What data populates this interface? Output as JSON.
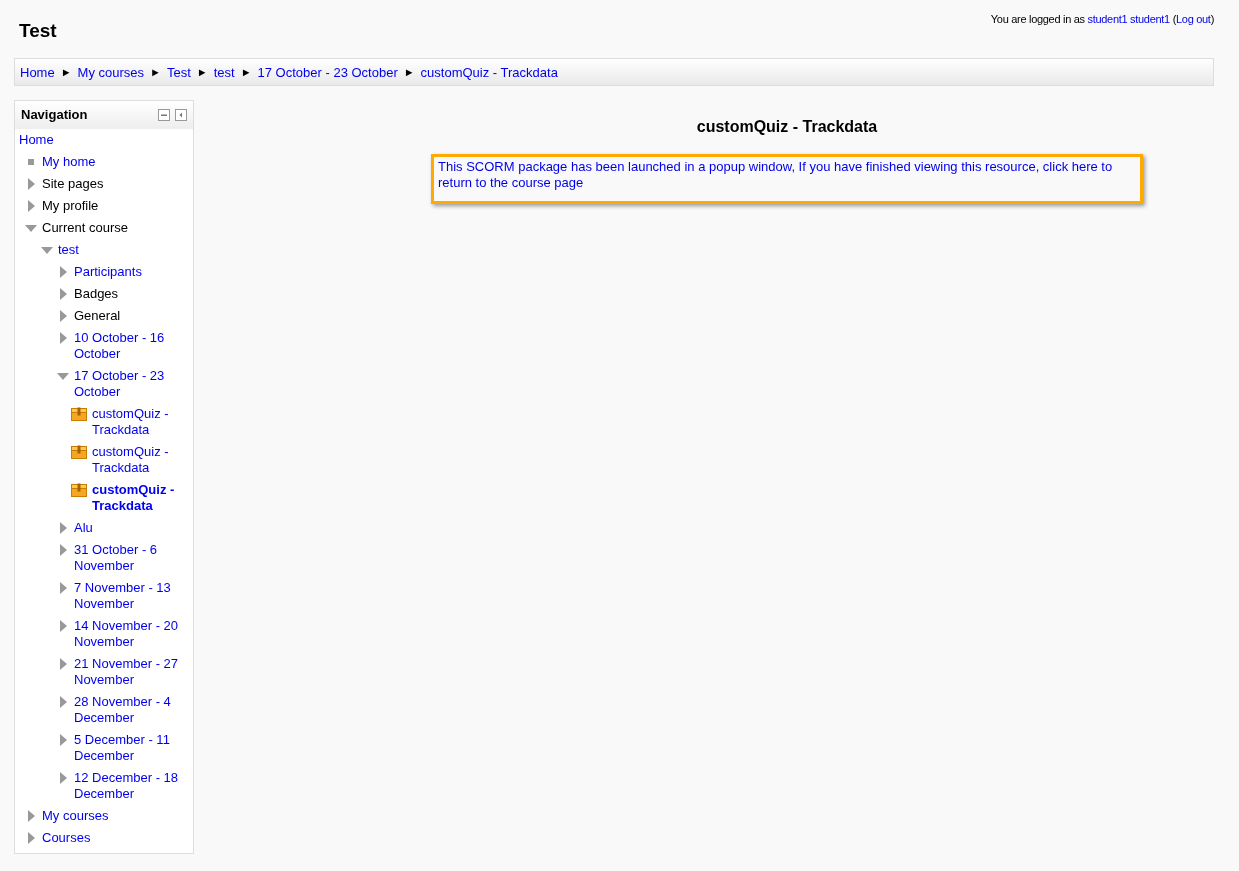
{
  "header": {
    "title": "Test",
    "login": {
      "prefix": "You are logged in as",
      "user": "student1 student1",
      "open": "(",
      "logout": "Log out",
      "close": ")"
    }
  },
  "breadcrumb": [
    {
      "label": "Home"
    },
    {
      "label": "My courses"
    },
    {
      "label": "Test"
    },
    {
      "label": "test"
    },
    {
      "label": "17 October - 23 October"
    },
    {
      "label": "customQuiz - Trackdata"
    }
  ],
  "breadcrumb_separator": "►",
  "navigation": {
    "title": "Navigation",
    "items": [
      {
        "label": "Home",
        "kind": "root",
        "link": true
      },
      {
        "label": "My home",
        "kind": "leaf",
        "link": true
      },
      {
        "label": "Site pages",
        "kind": "branch",
        "link": false,
        "expanded": false
      },
      {
        "label": "My profile",
        "kind": "branch",
        "link": false,
        "expanded": false
      },
      {
        "label": "Current course",
        "kind": "branch",
        "link": false,
        "expanded": true,
        "children": [
          {
            "label": "test",
            "kind": "branch",
            "link": true,
            "expanded": true,
            "children": [
              {
                "label": "Participants",
                "kind": "branch",
                "link": true,
                "expanded": false
              },
              {
                "label": "Badges",
                "kind": "branch",
                "link": false,
                "expanded": false
              },
              {
                "label": "General",
                "kind": "branch",
                "link": false,
                "expanded": false
              },
              {
                "label": "10 October - 16 October",
                "kind": "branch",
                "link": true,
                "expanded": false
              },
              {
                "label": "17 October - 23 October",
                "kind": "branch",
                "link": true,
                "expanded": true,
                "children": [
                  {
                    "label": "customQuiz - Trackdata",
                    "kind": "activity",
                    "link": true,
                    "current": false
                  },
                  {
                    "label": "customQuiz - Trackdata",
                    "kind": "activity",
                    "link": true,
                    "current": false
                  },
                  {
                    "label": "customQuiz - Trackdata",
                    "kind": "activity",
                    "link": true,
                    "current": true
                  }
                ]
              },
              {
                "label": "Alu",
                "kind": "branch",
                "link": true,
                "expanded": false
              },
              {
                "label": "31 October - 6 November",
                "kind": "branch",
                "link": true,
                "expanded": false
              },
              {
                "label": "7 November - 13 November",
                "kind": "branch",
                "link": true,
                "expanded": false
              },
              {
                "label": "14 November - 20 November",
                "kind": "branch",
                "link": true,
                "expanded": false
              },
              {
                "label": "21 November - 27 November",
                "kind": "branch",
                "link": true,
                "expanded": false
              },
              {
                "label": "28 November - 4 December",
                "kind": "branch",
                "link": true,
                "expanded": false
              },
              {
                "label": "5 December - 11 December",
                "kind": "branch",
                "link": true,
                "expanded": false
              },
              {
                "label": "12 December - 18 December",
                "kind": "branch",
                "link": true,
                "expanded": false
              }
            ]
          }
        ]
      },
      {
        "label": "My courses",
        "kind": "branch",
        "link": true,
        "expanded": false
      },
      {
        "label": "Courses",
        "kind": "branch",
        "link": true,
        "expanded": false
      }
    ]
  },
  "main": {
    "title": "customQuiz - Trackdata",
    "notice": "This SCORM package has been launched in a popup window, If you have finished viewing this resource, click here to return to the course page"
  }
}
